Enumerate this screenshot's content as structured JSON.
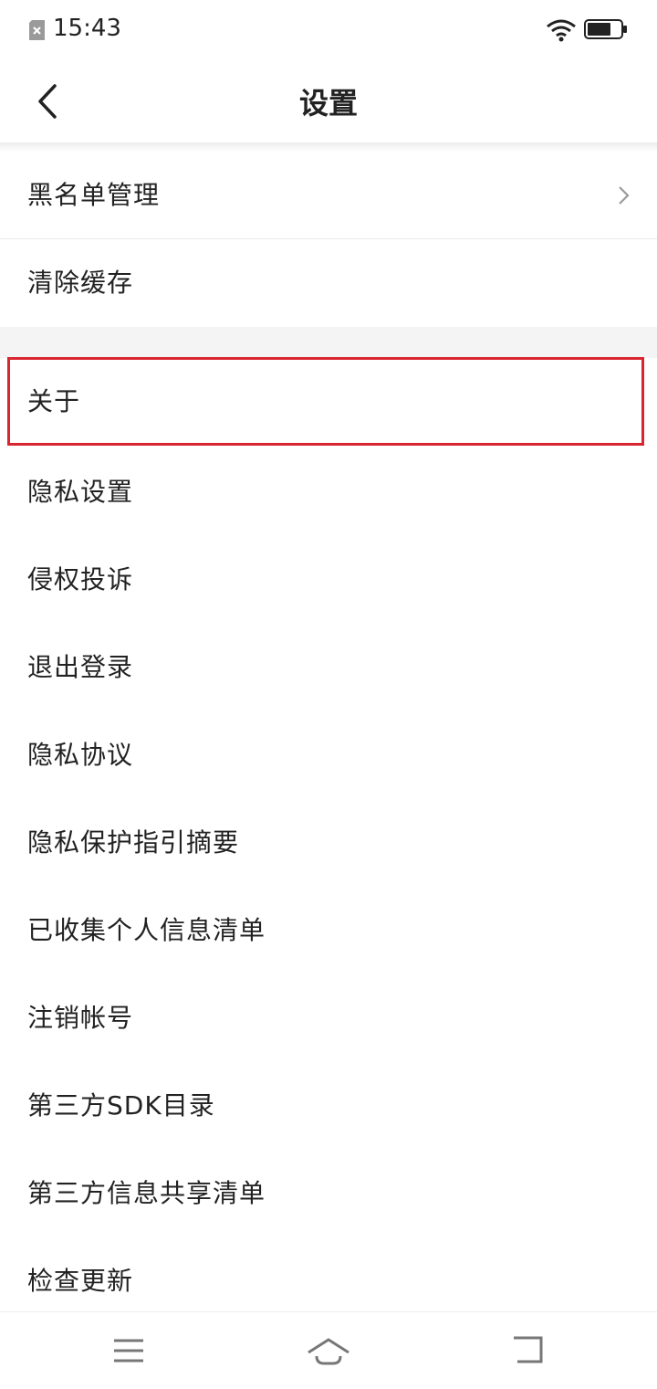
{
  "status_bar": {
    "time": "15:43",
    "icons": [
      "sim-error-icon",
      "wifi-icon",
      "battery-icon"
    ]
  },
  "header": {
    "title": "设置",
    "back_icon": "chevron-left-icon"
  },
  "group1": [
    {
      "label": "黑名单管理",
      "has_chevron": true
    },
    {
      "label": "清除缓存"
    }
  ],
  "group2": [
    {
      "label": "关于",
      "highlighted": true
    },
    {
      "label": "隐私设置"
    },
    {
      "label": "侵权投诉"
    },
    {
      "label": "退出登录"
    },
    {
      "label": "隐私协议"
    },
    {
      "label": "隐私保护指引摘要"
    },
    {
      "label": "已收集个人信息清单"
    },
    {
      "label": "注销帐号"
    },
    {
      "label": "第三方SDK目录"
    },
    {
      "label": "第三方信息共享清单"
    },
    {
      "label": "检查更新"
    }
  ],
  "nav_bar": {
    "icons": [
      "menu-icon",
      "home-icon",
      "back-nav-icon"
    ]
  },
  "colors": {
    "highlight": "#d9252f",
    "section_gap": "#f4f4f4",
    "divider": "#ececec"
  }
}
